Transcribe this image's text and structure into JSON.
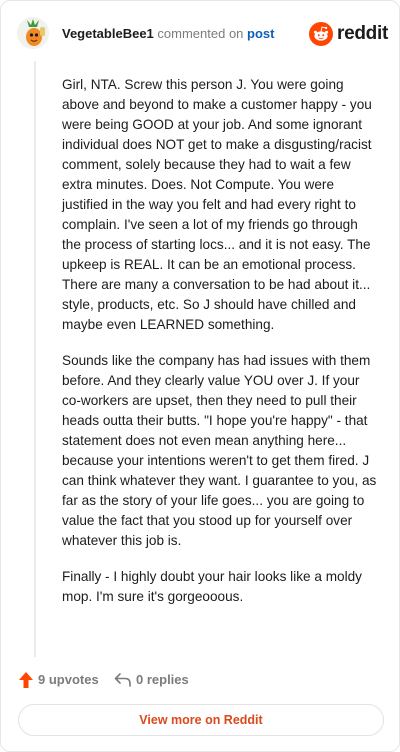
{
  "header": {
    "username": "VegetableBee1",
    "action_text": "commented on",
    "post_link": "post",
    "brand": "reddit"
  },
  "comment": {
    "paragraphs": [
      "Girl, NTA. Screw this person J. You were going above and beyond to make a customer happy - you were being GOOD at your job. And some ignorant individual does NOT get to make a disgusting/racist comment, solely because they had to wait a few extra minutes. Does. Not Compute. You were justified in the way you felt and had every right to complain. I've seen a lot of my friends go through the process of starting locs... and it is not easy. The upkeep is REAL. It can be an emotional process. There are many a conversation to be had about it... style, products, etc. So J should have chilled and maybe even LEARNED something.",
      "Sounds like the company has had issues with them before. And they clearly value YOU over J. If your co-workers are upset, then they need to pull their heads outta their butts. \"I hope you're happy\" - that statement does not even mean anything here... because your intentions weren't to get them fired. J can think whatever they want. I guarantee to you, as far as the story of your life goes... you are going to value the fact that you stood up for yourself over whatever this job is.",
      "Finally - I highly doubt your hair looks like a moldy mop. I'm sure it's gorgeooous."
    ]
  },
  "footer": {
    "upvotes": "9 upvotes",
    "replies": "0 replies",
    "view_more": "View more on Reddit"
  },
  "colors": {
    "accent": "#ff4500",
    "link": "#0f5fb5",
    "view_more": "#d94a1e",
    "muted": "#7c7c7c"
  },
  "icons": {
    "avatar": "avatar-icon",
    "brand": "reddit-logo-icon",
    "upvote": "upvote-arrow-icon",
    "reply": "reply-arrow-icon"
  }
}
